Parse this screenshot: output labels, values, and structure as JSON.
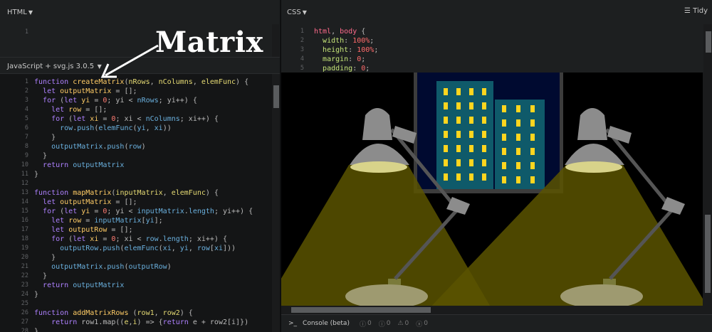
{
  "html_pane": {
    "title": "HTML",
    "line_numbers": [
      "1"
    ]
  },
  "js_pane": {
    "title": "JavaScript + svg.js 3.0.5",
    "line_numbers": [
      "1",
      "2",
      "3",
      "4",
      "5",
      "6",
      "7",
      "8",
      "9",
      "10",
      "11",
      "12",
      "13",
      "14",
      "15",
      "16",
      "17",
      "18",
      "19",
      "20",
      "21",
      "22",
      "23",
      "24",
      "25",
      "26",
      "27",
      "28"
    ]
  },
  "css_pane": {
    "title": "CSS",
    "tidy_label": "Tidy",
    "line_numbers": [
      "1",
      "2",
      "3",
      "4",
      "5"
    ]
  },
  "annotation": {
    "text": "Matrix"
  },
  "console": {
    "label": "Console (beta)",
    "counts": [
      "0",
      "0",
      "0",
      "0"
    ]
  },
  "colors": {
    "wall": "#000000",
    "floor": "#6b6300",
    "window_frame": "#444444",
    "sky": "#000a30",
    "building": "#0f5a6a",
    "window_light": "#ffd51f",
    "lamp": "#8c8c8c",
    "light_cone": "#5a5400"
  }
}
